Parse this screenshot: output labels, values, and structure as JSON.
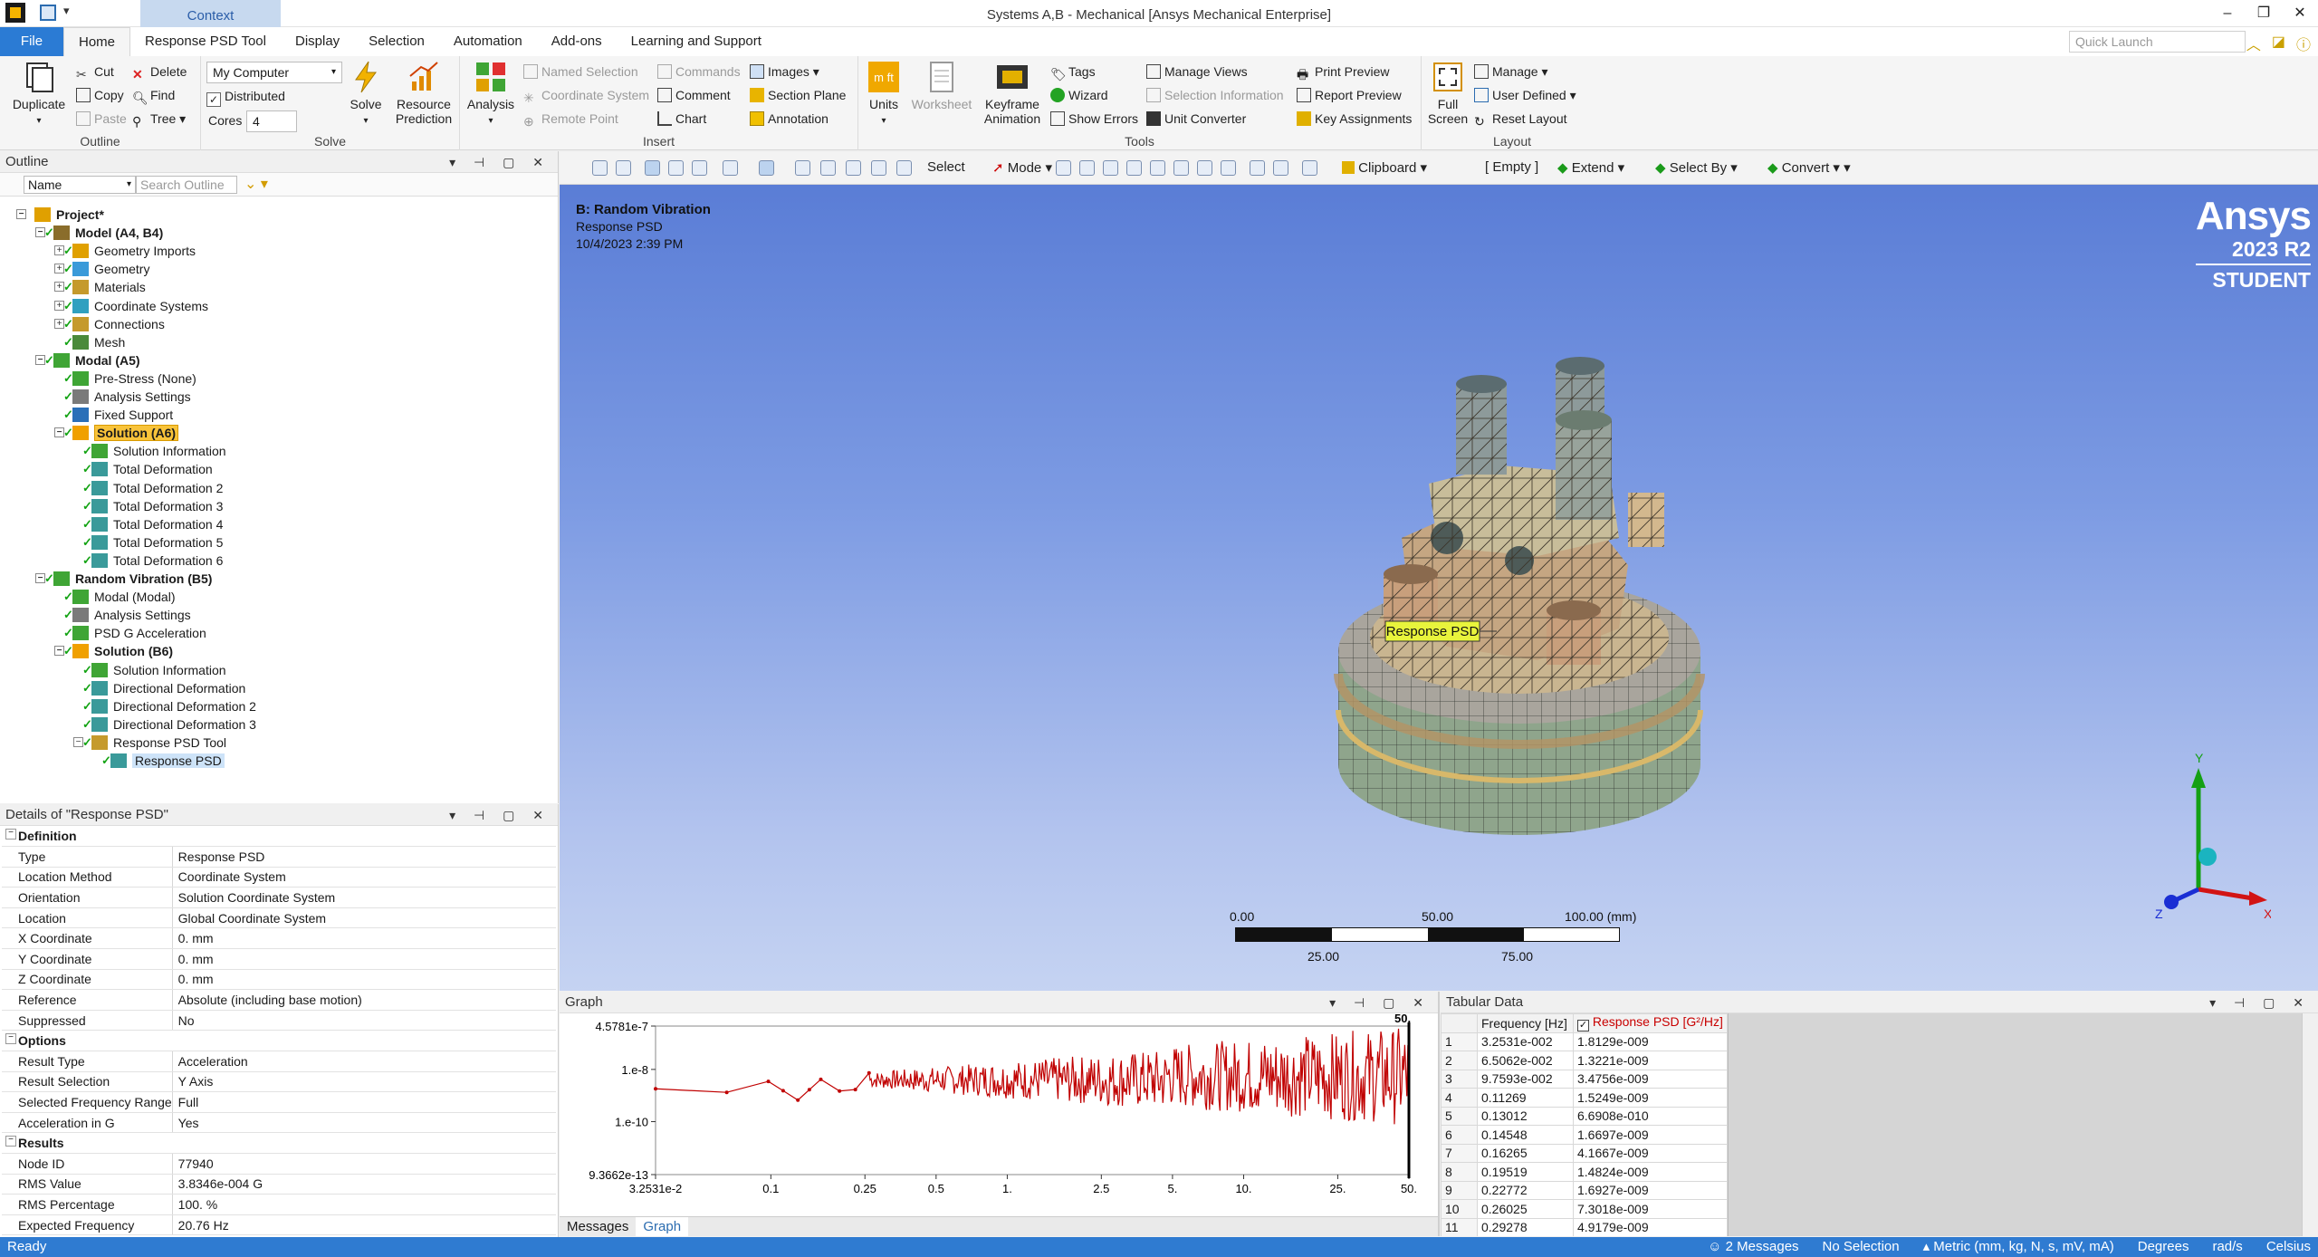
{
  "titlebar": {
    "context_tab": "Context",
    "title": "Systems A,B - Mechanical [Ansys Mechanical Enterprise]",
    "quick_launch_placeholder": "Quick Launch"
  },
  "tabs": [
    "File",
    "Home",
    "Response PSD Tool",
    "Display",
    "Selection",
    "Automation",
    "Add-ons",
    "Learning and Support"
  ],
  "ribbon": {
    "outline": {
      "label": "Outline",
      "duplicate": "Duplicate",
      "cut": "Cut",
      "copy": "Copy",
      "paste": "Paste",
      "delete": "Delete",
      "find": "Find",
      "tree": "Tree"
    },
    "solve": {
      "label": "Solve",
      "computer": "My Computer",
      "distributed": "Distributed",
      "cores_label": "Cores",
      "cores": "4",
      "solve": "Solve",
      "resource": "Resource",
      "prediction": "Prediction"
    },
    "insert": {
      "label": "Insert",
      "analysis": "Analysis",
      "named_selection": "Named Selection",
      "coordinate_system": "Coordinate System",
      "remote_point": "Remote Point",
      "commands": "Commands",
      "comment": "Comment",
      "chart": "Chart",
      "images": "Images",
      "section_plane": "Section Plane",
      "annotation": "Annotation"
    },
    "tools": {
      "label": "Tools",
      "units": "Units",
      "worksheet": "Worksheet",
      "keyframe": "Keyframe",
      "animation": "Animation",
      "tags": "Tags",
      "wizard": "Wizard",
      "show_errors": "Show Errors",
      "manage_views": "Manage Views",
      "selection_information": "Selection Information",
      "unit_converter": "Unit Converter",
      "print_preview": "Print Preview",
      "report_preview": "Report Preview",
      "key_assignments": "Key Assignments"
    },
    "layout": {
      "label": "Layout",
      "full": "Full",
      "screen": "Screen",
      "manage": "Manage",
      "user_defined": "User Defined",
      "reset_layout": "Reset Layout"
    }
  },
  "outline": {
    "title": "Outline",
    "filter_name": "Name",
    "search_placeholder": "Search Outline",
    "nodes": [
      {
        "label": "Project*",
        "bold": true
      },
      {
        "label": "Model (A4, B4)",
        "bold": true
      },
      {
        "label": "Geometry Imports"
      },
      {
        "label": "Geometry"
      },
      {
        "label": "Materials"
      },
      {
        "label": "Coordinate Systems"
      },
      {
        "label": "Connections"
      },
      {
        "label": "Mesh"
      },
      {
        "label": "Modal (A5)",
        "bold": true
      },
      {
        "label": "Pre-Stress (None)"
      },
      {
        "label": "Analysis Settings"
      },
      {
        "label": "Fixed Support"
      },
      {
        "label": "Solution (A6)",
        "bold": true
      },
      {
        "label": "Solution Information"
      },
      {
        "label": "Total Deformation"
      },
      {
        "label": "Total Deformation 2"
      },
      {
        "label": "Total Deformation 3"
      },
      {
        "label": "Total Deformation 4"
      },
      {
        "label": "Total Deformation 5"
      },
      {
        "label": "Total Deformation 6"
      },
      {
        "label": "Random Vibration (B5)",
        "bold": true
      },
      {
        "label": "Modal (Modal)"
      },
      {
        "label": "Analysis Settings"
      },
      {
        "label": "PSD G Acceleration"
      },
      {
        "label": "Solution (B6)",
        "bold": true
      },
      {
        "label": "Solution Information"
      },
      {
        "label": "Directional Deformation"
      },
      {
        "label": "Directional Deformation 2"
      },
      {
        "label": "Directional Deformation 3"
      },
      {
        "label": "Response PSD Tool"
      },
      {
        "label": "Response PSD"
      }
    ]
  },
  "details": {
    "title": "Details of \"Response PSD\"",
    "rows": [
      {
        "section": "Definition"
      },
      {
        "k": "Type",
        "v": "Response PSD"
      },
      {
        "k": "Location Method",
        "v": "Coordinate System"
      },
      {
        "k": "Orientation",
        "v": "Solution Coordinate System"
      },
      {
        "k": "Location",
        "v": "Global Coordinate System"
      },
      {
        "k": "X Coordinate",
        "v": "0. mm"
      },
      {
        "k": "Y Coordinate",
        "v": "0. mm"
      },
      {
        "k": "Z Coordinate",
        "v": "0. mm"
      },
      {
        "k": "Reference",
        "v": "Absolute (including base motion)"
      },
      {
        "k": "Suppressed",
        "v": "No"
      },
      {
        "section": "Options"
      },
      {
        "k": "Result Type",
        "v": "Acceleration"
      },
      {
        "k": "Result Selection",
        "v": "Y Axis"
      },
      {
        "k": "Selected Frequency Range",
        "v": "Full"
      },
      {
        "k": "Acceleration in G",
        "v": "Yes"
      },
      {
        "section": "Results"
      },
      {
        "k": "Node ID",
        "v": "77940"
      },
      {
        "k": "RMS Value",
        "v": "3.8346e-004 G"
      },
      {
        "k": "RMS Percentage",
        "v": "100. %"
      },
      {
        "k": "Expected Frequency",
        "v": "20.76 Hz"
      }
    ]
  },
  "viewtoolbar": {
    "select": "Select",
    "mode": "Mode",
    "clipboard": "Clipboard",
    "empty": "[ Empty ]",
    "extend": "Extend",
    "select_by": "Select By",
    "convert": "Convert"
  },
  "viewport": {
    "analysis": "B: Random Vibration",
    "result": "Response PSD",
    "date": "10/4/2023 2:39 PM",
    "logo": "Ansys",
    "version": "2023 R2",
    "edition": "STUDENT",
    "probe_label": "Response PSD",
    "scale": {
      "l0": "0.00",
      "l50": "50.00",
      "l100": "100.00 (mm)",
      "l25": "25.00",
      "l75": "75.00"
    },
    "axes": {
      "x": "X",
      "y": "Y",
      "z": "Z"
    }
  },
  "graph": {
    "title": "Graph",
    "tabs": [
      "Messages",
      "Graph"
    ],
    "marker": "50.",
    "yticks": [
      "4.5781e-7",
      "1.e-8",
      "1.e-10",
      "9.3662e-13"
    ],
    "xticks": [
      "3.2531e-2",
      "0.1",
      "0.25",
      "0.5",
      "1.",
      "2.5",
      "5.",
      "10.",
      "25.",
      "50."
    ]
  },
  "chart_data": {
    "type": "line",
    "title": "",
    "xlabel": "",
    "ylabel": "",
    "x_scale": "log",
    "y_scale": "log",
    "xlim": [
      0.032531,
      50
    ],
    "ylim": [
      9.3662e-13,
      4.5781e-07
    ],
    "series": [
      {
        "name": "Response PSD [G²/Hz]",
        "color": "#c00000",
        "x": [
          0.032531,
          0.065062,
          0.097593,
          0.11269,
          0.13012,
          0.14548,
          0.16265,
          0.19519,
          0.22772,
          0.26025
        ],
        "y": [
          1.8129e-09,
          1.3221e-09,
          3.4756e-09,
          1.5249e-09,
          6.6908e-10,
          1.6697e-09,
          4.1667e-09,
          1.4824e-09,
          1.6927e-09,
          7.3018e-09
        ]
      }
    ]
  },
  "tabular": {
    "title": "Tabular Data",
    "col_freq": "Frequency [Hz]",
    "col_psd": "Response PSD [G²/Hz]",
    "rows": [
      [
        "1",
        "3.2531e-002",
        "1.8129e-009"
      ],
      [
        "2",
        "6.5062e-002",
        "1.3221e-009"
      ],
      [
        "3",
        "9.7593e-002",
        "3.4756e-009"
      ],
      [
        "4",
        "0.11269",
        "1.5249e-009"
      ],
      [
        "5",
        "0.13012",
        "6.6908e-010"
      ],
      [
        "6",
        "0.14548",
        "1.6697e-009"
      ],
      [
        "7",
        "0.16265",
        "4.1667e-009"
      ],
      [
        "8",
        "0.19519",
        "1.4824e-009"
      ],
      [
        "9",
        "0.22772",
        "1.6927e-009"
      ],
      [
        "10",
        "0.26025",
        "7.3018e-009"
      ],
      [
        "11",
        "0.29278",
        "4.9179e-009"
      ]
    ]
  },
  "status": {
    "ready": "Ready",
    "messages": "2 Messages",
    "selection": "No Selection",
    "units": "Metric (mm, kg, N, s, mV, mA)",
    "degrees": "Degrees",
    "rads": "rad/s",
    "temp": "Celsius"
  }
}
